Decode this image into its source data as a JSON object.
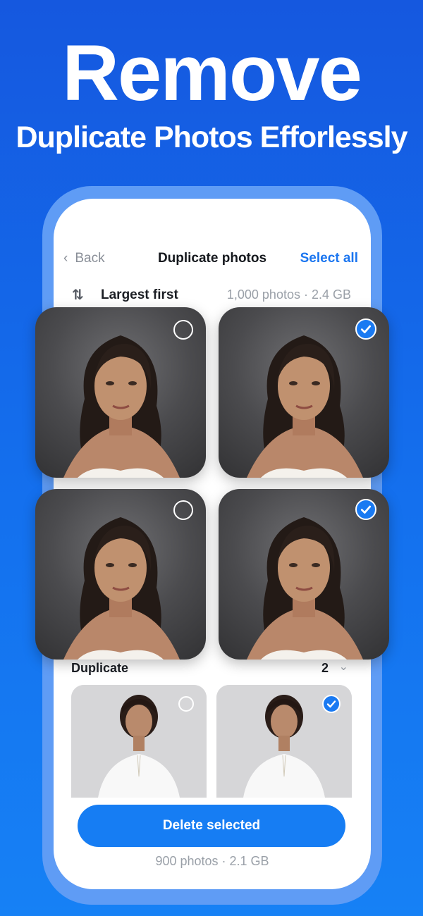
{
  "promo": {
    "headline": "Remove",
    "subheadline": "Duplicate Photos Efforlessly"
  },
  "nav": {
    "back_label": "Back",
    "title": "Duplicate photos",
    "select_all_label": "Select all"
  },
  "sort": {
    "label": "Largest first",
    "meta": "1,000 photos · 2.4 GB"
  },
  "group": {
    "label": "Duplicate",
    "count": "2"
  },
  "photos": [
    {
      "selected": false,
      "subject": "woman-dark-background"
    },
    {
      "selected": true,
      "subject": "woman-dark-background"
    },
    {
      "selected": false,
      "subject": "woman-dark-background"
    },
    {
      "selected": true,
      "subject": "woman-dark-background"
    }
  ],
  "duplicate_photos": [
    {
      "selected": false,
      "subject": "woman-white-sweater"
    },
    {
      "selected": true,
      "subject": "woman-white-sweater"
    }
  ],
  "footer": {
    "delete_label": "Delete selected",
    "meta": "900 photos · 2.1 GB"
  },
  "colors": {
    "accent": "#167df3",
    "background_top": "#1558df",
    "background_bottom": "#1681f5"
  },
  "icons": [
    "chevron-left-icon",
    "sort-arrows-icon",
    "chevron-down-icon",
    "check-icon",
    "empty-circle-icon"
  ]
}
